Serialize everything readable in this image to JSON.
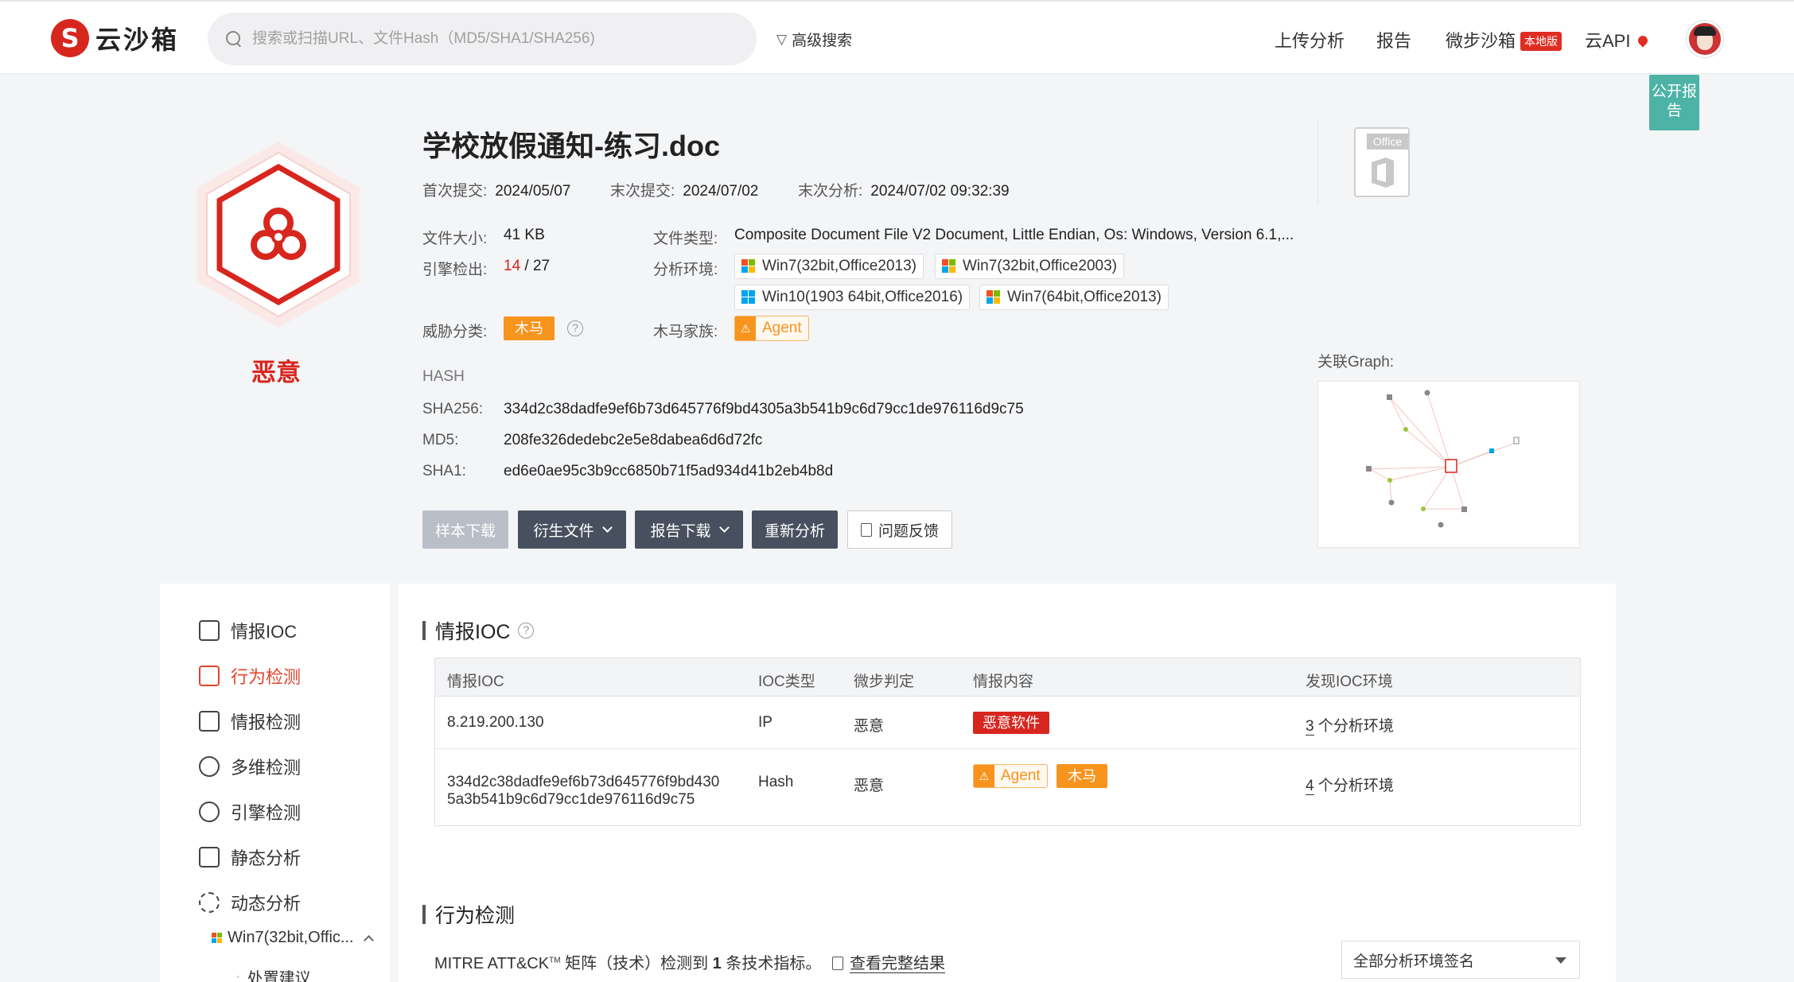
{
  "header": {
    "logo_mark": "S",
    "logo_text": "云沙箱",
    "search_placeholder": "搜索或扫描URL、文件Hash（MD5/SHA1/SHA256)",
    "advanced_search": "高级搜索",
    "nav": [
      "上传分析",
      "报告",
      "微步沙箱",
      "云API"
    ],
    "local_badge": "本地版"
  },
  "public_report": "公开报告",
  "verdict": {
    "label": "恶意",
    "color": "#d7261e"
  },
  "file": {
    "title": "学校放假通知-练习.doc",
    "first_submit_label": "首次提交:",
    "first_submit": "2024/05/07",
    "last_submit_label": "末次提交:",
    "last_submit": "2024/07/02",
    "last_analysis_label": "末次分析:",
    "last_analysis": "2024/07/02 09:32:39",
    "size_label": "文件大小:",
    "size": "41 KB",
    "engine_label": "引擎检出:",
    "engine_detect": "14",
    "engine_total": "/ 27",
    "type_label": "文件类型:",
    "type": "Composite Document File V2 Document, Little Endian, Os: Windows, Version 6.1,...",
    "env_label": "分析环境:",
    "envs": [
      "Win7(32bit,Office2013)",
      "Win7(32bit,Office2003)",
      "Win10(1903 64bit,Office2016)",
      "Win7(64bit,Office2013)"
    ],
    "threat_label": "威胁分类:",
    "threat": "木马",
    "family_label": "木马家族:",
    "family": "Agent",
    "office_badge": "Office"
  },
  "hash": {
    "heading": "HASH",
    "sha256_label": "SHA256:",
    "sha256": "334d2c38dadfe9ef6b73d645776f9bd4305a3b541b9c6d79cc1de976116d9c75",
    "md5_label": "MD5:",
    "md5": "208fe326dedebc2e5e8dabea6d6d72fc",
    "sha1_label": "SHA1:",
    "sha1": "ed6e0ae95c3b9cc6850b71f5ad934d41b2eb4b8d"
  },
  "buttons": {
    "sample_download": "样本下载",
    "derived_files": "衍生文件",
    "report_download": "报告下载",
    "reanalyze": "重新分析",
    "feedback": "问题反馈"
  },
  "graph_label": "关联Graph:",
  "sidebar": {
    "items": [
      "情报IOC",
      "行为检测",
      "情报检测",
      "多维检测",
      "引擎检测",
      "静态分析",
      "动态分析"
    ],
    "active_index": 1,
    "sub_env": "Win7(32bit,Offic...",
    "sub_item": "处置建议"
  },
  "ioc": {
    "title": "情报IOC",
    "headers": [
      "情报IOC",
      "IOC类型",
      "微步判定",
      "情报内容",
      "发现IOC环境"
    ],
    "rows": [
      {
        "ioc": "8.219.200.130",
        "type": "IP",
        "verdict": "恶意",
        "intel": "恶意软件",
        "env_count": "3",
        "env_suffix": "个分析环境"
      },
      {
        "ioc_line1": "334d2c38dadfe9ef6b73d645776f9bd430",
        "ioc_line2": "5a3b541b9c6d79cc1de976116d9c75",
        "type": "Hash",
        "verdict": "恶意",
        "intel_family": "Agent",
        "intel_class": "木马",
        "env_count": "4",
        "env_suffix": "个分析环境"
      }
    ]
  },
  "behavior": {
    "title": "行为检测",
    "mitre_prefix": "MITRE ATT&CK",
    "mitre_tm": "TM",
    "mitre_mid": " 矩阵（技术）检测到 ",
    "mitre_count": "1",
    "mitre_suffix": " 条技术指标。",
    "view_full": "查看完整结果",
    "select_value": "全部分析环境签名"
  },
  "colors": {
    "accent": "#d7261e",
    "orange": "#f7941e",
    "teal": "#4db3a6",
    "dark_button": "#48505f"
  }
}
